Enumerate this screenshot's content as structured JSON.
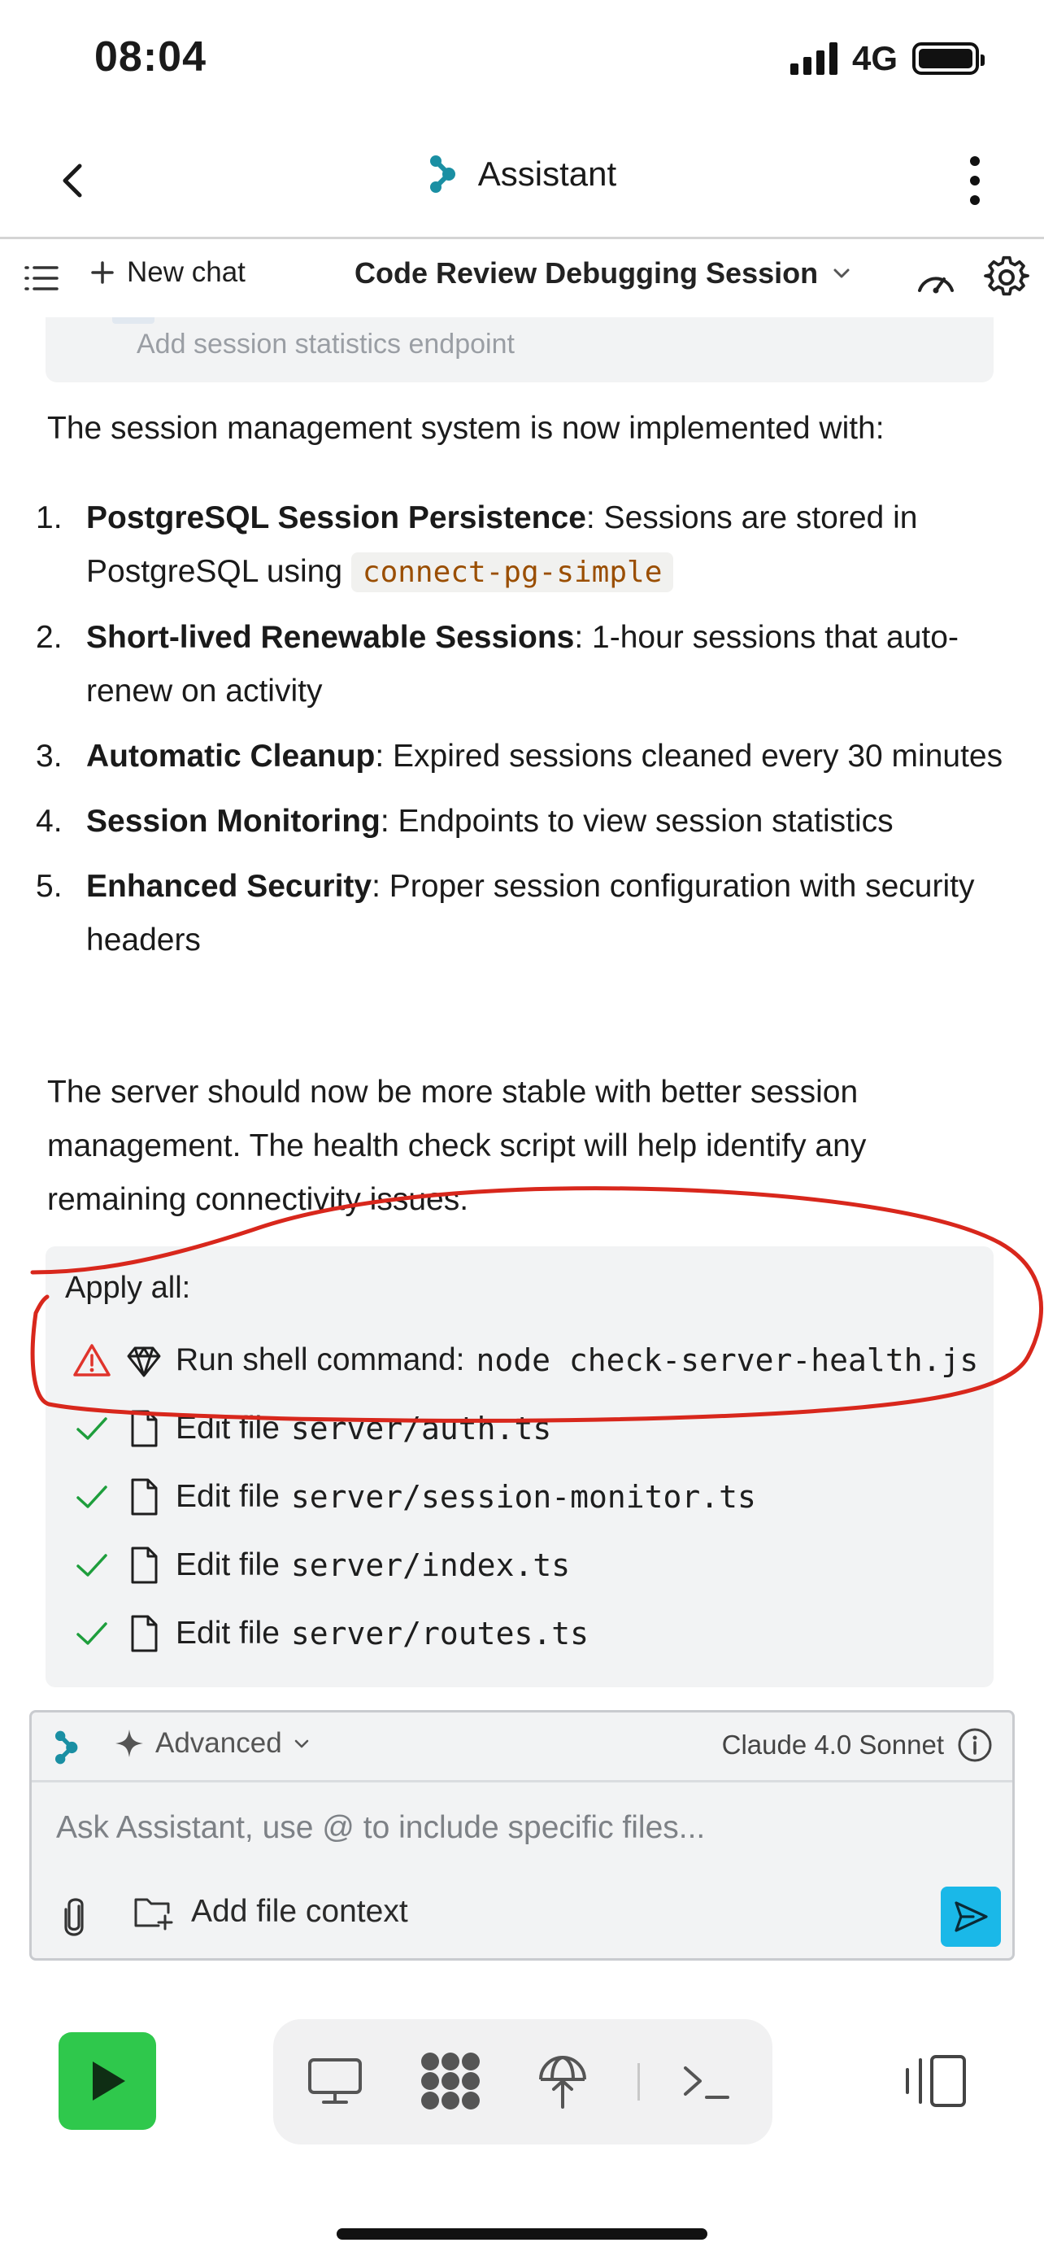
{
  "status_bar": {
    "time": "08:04",
    "network": "4G"
  },
  "header": {
    "title": "Assistant"
  },
  "toolbar": {
    "new_chat": "New chat",
    "session_title": "Code Review Debugging Session"
  },
  "previous_card": {
    "text": "Add session statistics endpoint"
  },
  "message": {
    "intro": "The session management system is now implemented with:",
    "items": [
      {
        "num": "1.",
        "title": "PostgreSQL Session Persistence",
        "text": ": Sessions are stored in PostgreSQL using ",
        "code": "connect-pg-simple"
      },
      {
        "num": "2.",
        "title": "Short-lived Renewable Sessions",
        "text": ": 1-hour sessions that auto-renew on activity"
      },
      {
        "num": "3.",
        "title": "Automatic Cleanup",
        "text": ": Expired sessions cleaned every 30 minutes"
      },
      {
        "num": "4.",
        "title": "Session Monitoring",
        "text": ": Endpoints to view session statistics"
      },
      {
        "num": "5.",
        "title": "Enhanced Security",
        "text": ": Proper session configuration with security headers"
      }
    ],
    "outro": "The server should now be more stable with better session management. The health check script will help identify any remaining connectivity issues."
  },
  "apply": {
    "title": "Apply all:",
    "shell": {
      "label": "Run shell command:",
      "command": "node check-server-health.js"
    },
    "edits": [
      {
        "label": "Edit file",
        "path": "server/auth.ts"
      },
      {
        "label": "Edit file",
        "path": "server/session-monitor.ts"
      },
      {
        "label": "Edit file",
        "path": "server/index.ts"
      },
      {
        "label": "Edit file",
        "path": "server/routes.ts"
      }
    ]
  },
  "input": {
    "mode": "Advanced",
    "model": "Claude 4.0 Sonnet",
    "placeholder": "Ask Assistant, use @ to include specific files...",
    "add_context": "Add file context"
  },
  "colors": {
    "accent_teal": "#1a8fa3",
    "send_blue": "#1ab8e8",
    "run_green": "#2fc84c",
    "check_green": "#1e9e3c",
    "warning_red": "#e0342c",
    "annotation_red": "#d8271c",
    "code_orange": "#9a4e00"
  }
}
